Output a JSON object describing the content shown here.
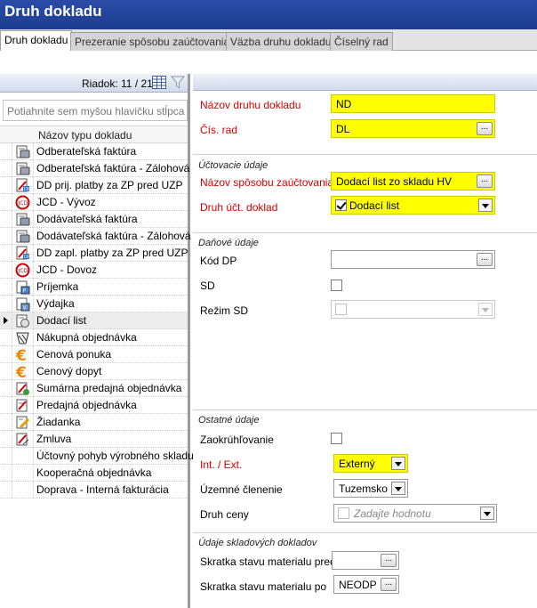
{
  "window": {
    "title": "Druh dokladu"
  },
  "tabs": [
    {
      "label": "Druh dokladu",
      "active": true
    },
    {
      "label": "Prezeranie spôsobu zaúčtovania",
      "active": false
    },
    {
      "label": "Väzba druhu dokladu",
      "active": false
    },
    {
      "label": "Číselný rad",
      "active": false
    }
  ],
  "grid": {
    "row_counter": "Riadok: 11 / 21",
    "group_hint": "Potiahnite sem myšou hlavičku stĺpca",
    "column_header": "Názov typu dokladu",
    "selected_index": 10,
    "rows": [
      {
        "label": "Odberateľská faktúra",
        "icon": "invoice-out-icon"
      },
      {
        "label": "Odberateľská faktúra - Zálohová",
        "icon": "invoice-out-icon"
      },
      {
        "label": "DD prij. platby za ZP pred UZP",
        "icon": "tax-doc-icon"
      },
      {
        "label": "JCD - Vývoz",
        "icon": "customs-icon"
      },
      {
        "label": "Dodávateľská faktúra",
        "icon": "invoice-in-icon"
      },
      {
        "label": "Dodávateľská faktúra - Zálohová",
        "icon": "invoice-in-icon"
      },
      {
        "label": "DD zapl. platby za ZP pred UZP",
        "icon": "tax-doc-icon"
      },
      {
        "label": "JCD - Dovoz",
        "icon": "customs-icon"
      },
      {
        "label": "Príjemka",
        "icon": "receipt-icon"
      },
      {
        "label": "Výdajka",
        "icon": "issue-slip-icon"
      },
      {
        "label": "Dodací list",
        "icon": "delivery-note-icon"
      },
      {
        "label": "Nákupná objednávka",
        "icon": "purchase-order-icon"
      },
      {
        "label": "Cenová ponuka",
        "icon": "euro-icon"
      },
      {
        "label": "Cenový dopyt",
        "icon": "euro-icon"
      },
      {
        "label": "Sumárna predajná objednávka",
        "icon": "summary-order-icon"
      },
      {
        "label": "Predajná objednávka",
        "icon": "sales-order-icon"
      },
      {
        "label": "Žiadanka",
        "icon": "request-icon"
      },
      {
        "label": "Zmluva",
        "icon": "contract-icon"
      },
      {
        "label": "Účtovný pohyb výrobného skladu",
        "icon": ""
      },
      {
        "label": "Kooperačná objednávka",
        "icon": ""
      },
      {
        "label": "Doprava - Interná fakturácia",
        "icon": ""
      }
    ]
  },
  "form": {
    "nazov_label": "Názov druhu dokladu",
    "nazov_value": "ND",
    "cis_rad_label": "Čís. rad",
    "cis_rad_value": "DL",
    "uctovacie_title": "Účtovacie údaje",
    "sposob_label": "Názov spôsobu zaúčtovania",
    "sposob_value": "Dodací list zo skladu HV",
    "druh_uct_label": "Druh účt. doklad",
    "druh_uct_value": "Dodací list",
    "danove_title": "Daňové údaje",
    "kod_dp_label": "Kód DP",
    "kod_dp_value": "",
    "sd_label": "SD",
    "rezim_sd_label": "Režim SD",
    "rezim_sd_value": "",
    "ostatne_title": "Ostatné údaje",
    "zaokruhlovanie_label": "Zaokrúhľovanie",
    "int_ext_label": "Int. / Ext.",
    "int_ext_value": "Externý",
    "uzemne_label": "Územné členenie",
    "uzemne_value": "Tuzemsko",
    "druh_ceny_label": "Druh ceny",
    "druh_ceny_placeholder": "Zadajte hodnotu",
    "sklad_title": "Údaje skladových dokladov",
    "skratka_pred_label": "Skratka stavu materialu pred",
    "skratka_pred_value": "",
    "skratka_po_label": "Skratka stavu materialu po",
    "skratka_po_value": "NEODP",
    "ellipsis": "..."
  },
  "colors": {
    "title_bar": "#1e3d8f",
    "required_label": "#d40000",
    "highlight_field": "#ffff00"
  }
}
